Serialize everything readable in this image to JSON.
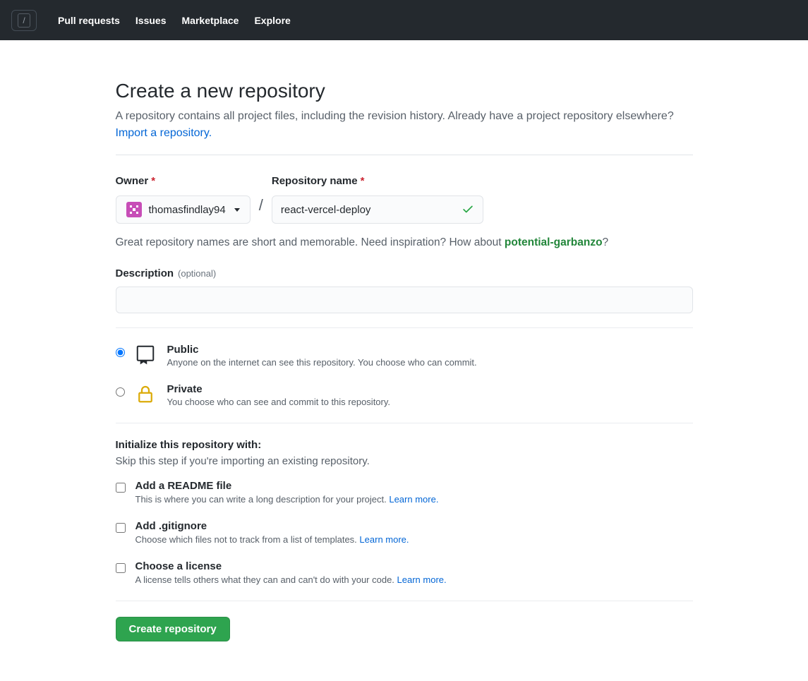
{
  "header": {
    "nav": [
      "Pull requests",
      "Issues",
      "Marketplace",
      "Explore"
    ],
    "searchKey": "/"
  },
  "page": {
    "title": "Create a new repository",
    "subtitle": "A repository contains all project files, including the revision history. Already have a project repository elsewhere? ",
    "importLink": "Import a repository."
  },
  "form": {
    "ownerLabel": "Owner",
    "repoLabel": "Repository name",
    "requiredMark": "*",
    "ownerValue": "thomasfindlay94",
    "separator": "/",
    "repoValue": "react-vercel-deploy",
    "hintPrefix": "Great repository names are short and memorable. Need inspiration? How about ",
    "suggestion": "potential-garbanzo",
    "hintSuffix": "?",
    "descLabel": "Description",
    "optional": "(optional)",
    "descValue": ""
  },
  "visibility": {
    "public": {
      "title": "Public",
      "desc": "Anyone on the internet can see this repository. You choose who can commit."
    },
    "private": {
      "title": "Private",
      "desc": "You choose who can see and commit to this repository."
    }
  },
  "init": {
    "title": "Initialize this repository with:",
    "subtitle": "Skip this step if you're importing an existing repository.",
    "readme": {
      "title": "Add a README file",
      "desc": "This is where you can write a long description for your project. ",
      "learn": "Learn more."
    },
    "gitignore": {
      "title": "Add .gitignore",
      "desc": "Choose which files not to track from a list of templates. ",
      "learn": "Learn more."
    },
    "license": {
      "title": "Choose a license",
      "desc": "A license tells others what they can and can't do with your code. ",
      "learn": "Learn more."
    }
  },
  "submit": "Create repository"
}
